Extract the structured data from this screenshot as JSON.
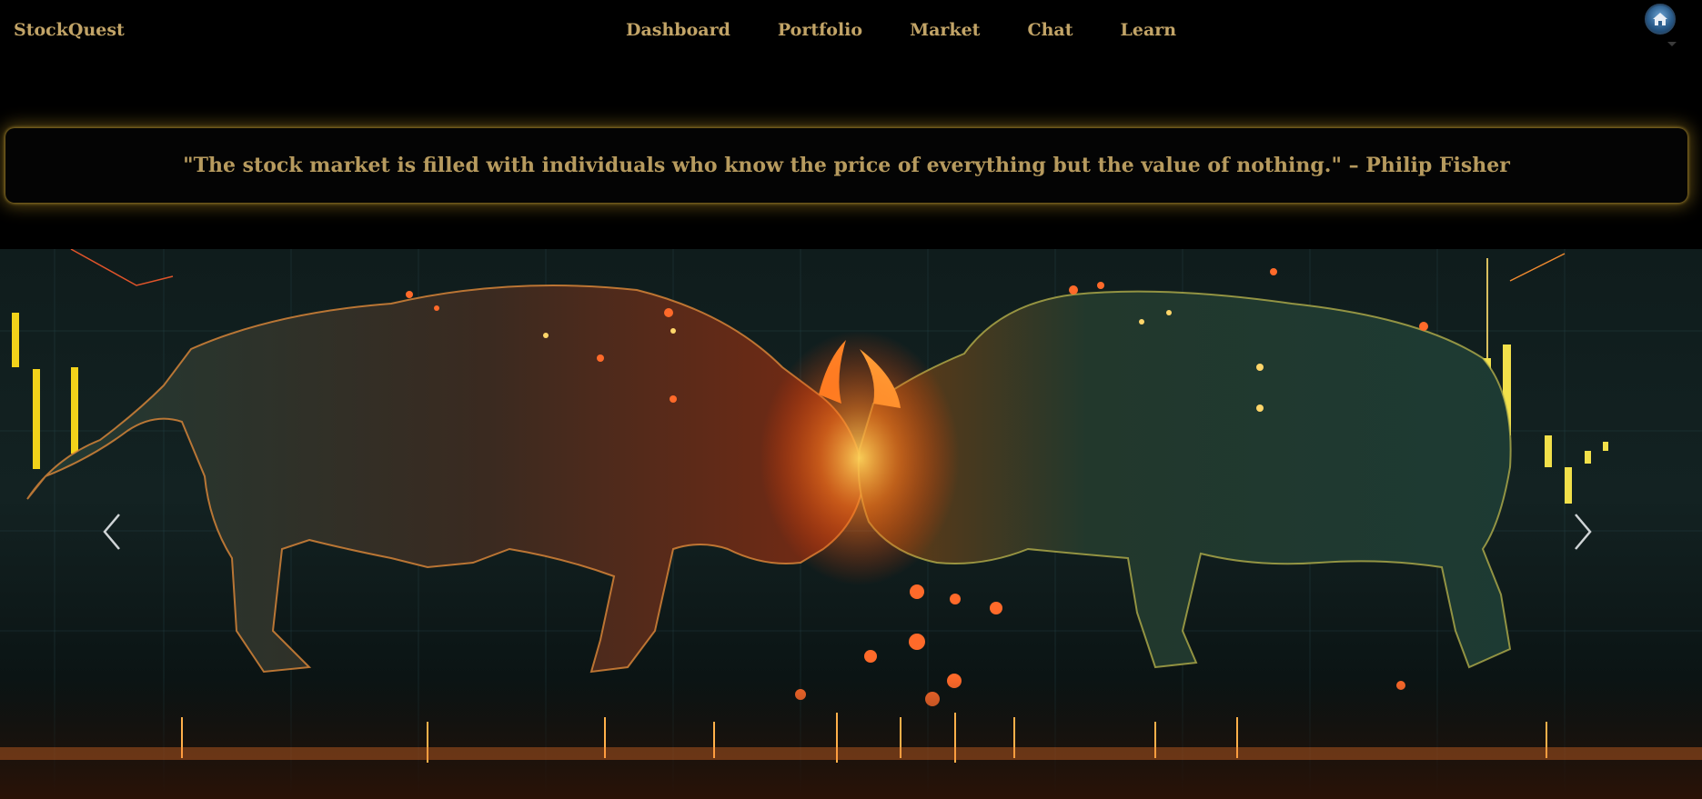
{
  "navbar": {
    "brand": "StockQuest",
    "links": [
      {
        "label": "Dashboard"
      },
      {
        "label": "Portfolio"
      },
      {
        "label": "Market"
      },
      {
        "label": "Chat"
      },
      {
        "label": "Learn"
      }
    ],
    "avatar_icon": "user-avatar-icon"
  },
  "quote": {
    "text": "\"The stock market is filled with individuals who know the price of everything but the value of nothing.\" – Philip Fisher"
  },
  "carousel": {
    "prev_icon": "chevron-left-icon",
    "next_icon": "chevron-right-icon",
    "image_subject": "two glowing bulls clashing over a market chart"
  },
  "colors": {
    "background": "#000000",
    "accent_text": "#c2a467",
    "quote_glow": "#be9628",
    "bull_left": "#e0542a",
    "bull_right": "#2fa67a"
  }
}
